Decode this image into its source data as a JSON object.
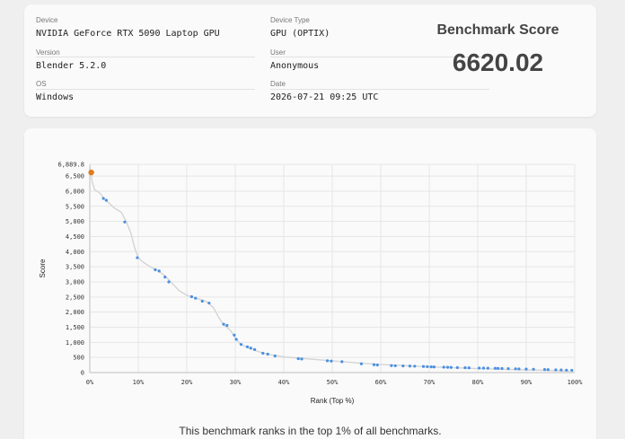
{
  "info": {
    "device_label": "Device",
    "device_value": "NVIDIA GeForce RTX 5090 Laptop GPU",
    "version_label": "Version",
    "version_value": "Blender 5.2.0",
    "os_label": "OS",
    "os_value": "Windows",
    "device_type_label": "Device Type",
    "device_type_value": "GPU (OPTIX)",
    "user_label": "User",
    "user_value": "Anonymous",
    "date_label": "Date",
    "date_value": "2026-07-21 09:25 UTC"
  },
  "score": {
    "title": "Benchmark Score",
    "value": "6620.02"
  },
  "rank_note": "This benchmark ranks in the top 1% of all benchmarks.",
  "chart_data": {
    "type": "scatter",
    "xlabel": "Rank (Top %)",
    "ylabel": "Score",
    "xlim": [
      0,
      100
    ],
    "ylim": [
      0,
      6889.8
    ],
    "x_ticks": [
      "0%",
      "10%",
      "20%",
      "30%",
      "40%",
      "50%",
      "60%",
      "70%",
      "80%",
      "90%",
      "100%"
    ],
    "y_ticks": [
      "0",
      "500",
      "1,000",
      "1,500",
      "2,000",
      "2,500",
      "3,000",
      "3,500",
      "4,000",
      "4,500",
      "5,000",
      "5,500",
      "6,000",
      "6,500"
    ],
    "y_max_label": "6,889.8",
    "grid": true,
    "colors": {
      "points": "#4a90e2",
      "highlight": "#e07b1e",
      "curve": "#d4d4d4"
    },
    "curve": [
      [
        0,
        6889.8
      ],
      [
        0.5,
        6300
      ],
      [
        1,
        6050
      ],
      [
        2,
        5950
      ],
      [
        3,
        5750
      ],
      [
        5,
        5450
      ],
      [
        6.5,
        5300
      ],
      [
        7.5,
        5000
      ],
      [
        8.5,
        4600
      ],
      [
        9.3,
        4100
      ],
      [
        10,
        3800
      ],
      [
        11,
        3650
      ],
      [
        13,
        3450
      ],
      [
        14,
        3380
      ],
      [
        15.5,
        3200
      ],
      [
        17,
        2950
      ],
      [
        18.5,
        2700
      ],
      [
        20,
        2560
      ],
      [
        22,
        2460
      ],
      [
        24,
        2350
      ],
      [
        25.5,
        2150
      ],
      [
        26.5,
        1850
      ],
      [
        27.5,
        1600
      ],
      [
        29,
        1400
      ],
      [
        30,
        1150
      ],
      [
        31,
        950
      ],
      [
        33,
        800
      ],
      [
        35,
        680
      ],
      [
        37,
        600
      ],
      [
        40,
        520
      ],
      [
        45,
        450
      ],
      [
        50,
        390
      ],
      [
        55,
        320
      ],
      [
        60,
        270
      ],
      [
        65,
        230
      ],
      [
        70,
        190
      ],
      [
        75,
        160
      ],
      [
        80,
        130
      ],
      [
        85,
        110
      ],
      [
        90,
        90
      ],
      [
        95,
        70
      ],
      [
        99,
        50
      ]
    ],
    "points": [
      [
        2.8,
        5760
      ],
      [
        3.4,
        5700
      ],
      [
        7.2,
        4980
      ],
      [
        9.8,
        3800
      ],
      [
        13.5,
        3400
      ],
      [
        14.3,
        3360
      ],
      [
        15.5,
        3160
      ],
      [
        16.3,
        3000
      ],
      [
        21,
        2510
      ],
      [
        21.8,
        2460
      ],
      [
        23.2,
        2360
      ],
      [
        24.6,
        2300
      ],
      [
        27.6,
        1600
      ],
      [
        28.3,
        1560
      ],
      [
        29.8,
        1240
      ],
      [
        30.2,
        1100
      ],
      [
        31.2,
        930
      ],
      [
        32.5,
        850
      ],
      [
        33.2,
        810
      ],
      [
        34,
        760
      ],
      [
        35.7,
        640
      ],
      [
        36.7,
        610
      ],
      [
        38.2,
        550
      ],
      [
        43,
        460
      ],
      [
        43.7,
        450
      ],
      [
        49,
        390
      ],
      [
        49.8,
        380
      ],
      [
        52,
        360
      ],
      [
        56,
        290
      ],
      [
        58.6,
        260
      ],
      [
        59.3,
        250
      ],
      [
        62.2,
        230
      ],
      [
        63,
        225
      ],
      [
        64.6,
        220
      ],
      [
        66,
        215
      ],
      [
        67,
        210
      ],
      [
        68.8,
        200
      ],
      [
        69.6,
        195
      ],
      [
        70.4,
        190
      ],
      [
        71,
        185
      ],
      [
        73,
        180
      ],
      [
        73.8,
        175
      ],
      [
        74.5,
        170
      ],
      [
        75.8,
        165
      ],
      [
        77.4,
        160
      ],
      [
        78.2,
        155
      ],
      [
        80.3,
        150
      ],
      [
        81.2,
        148
      ],
      [
        82.1,
        145
      ],
      [
        83.6,
        140
      ],
      [
        84.2,
        138
      ],
      [
        85,
        135
      ],
      [
        86.3,
        130
      ],
      [
        87.8,
        125
      ],
      [
        88.5,
        120
      ],
      [
        90,
        115
      ],
      [
        91.5,
        110
      ],
      [
        93.8,
        100
      ],
      [
        94.5,
        97
      ],
      [
        96.1,
        90
      ],
      [
        97.2,
        85
      ],
      [
        98.3,
        80
      ],
      [
        99.4,
        75
      ]
    ],
    "highlight": [
      0.3,
      6620.02
    ]
  }
}
